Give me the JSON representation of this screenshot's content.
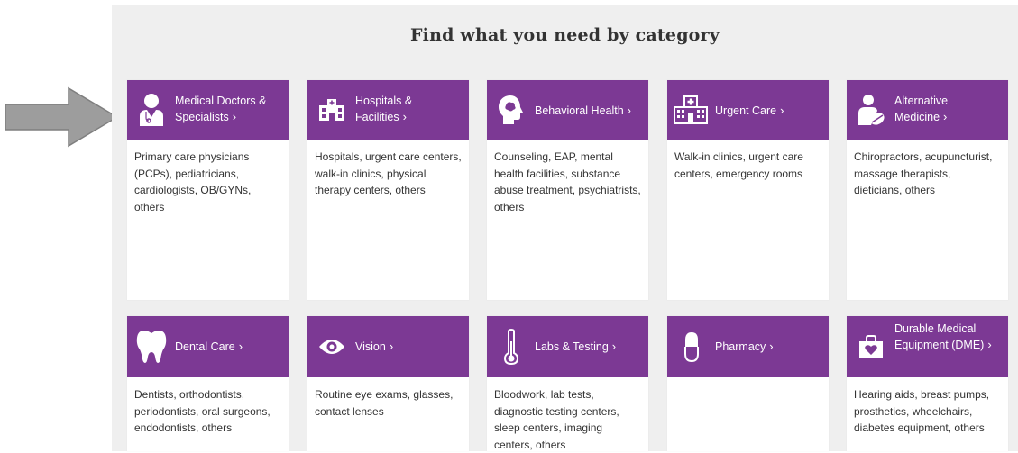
{
  "heading": "Find what you need by category",
  "colors": {
    "accent": "#7c3994",
    "panel": "#efefef",
    "arrow": "#9d9d9d",
    "text": "#333333"
  },
  "categories": [
    {
      "title": "Medical Doctors & Specialists",
      "icon": "doctor-icon",
      "description": "Primary care physicians (PCPs), pediatricians, cardiologists, OB/GYNs, others"
    },
    {
      "title": "Hospitals & Facilities",
      "icon": "hospital-building-icon",
      "description": "Hospitals, urgent care centers, walk-in clinics, physical therapy centers, others"
    },
    {
      "title": "Behavioral Health",
      "icon": "head-profile-icon",
      "description": "Counseling, EAP, mental health facilities, substance abuse treatment, psychiatrists, others"
    },
    {
      "title": "Urgent Care",
      "icon": "urgent-care-building-icon",
      "description": "Walk-in clinics, urgent care centers, emergency rooms"
    },
    {
      "title": "Alternative Medicine",
      "icon": "alternative-medicine-icon",
      "description": "Chiropractors, acupuncturist, massage therapists, dieticians, others"
    },
    {
      "title": "Dental Care",
      "icon": "tooth-icon",
      "description": "Dentists, orthodontists, periodontists, oral surgeons, endodontists, others"
    },
    {
      "title": "Vision",
      "icon": "eye-icon",
      "description": "Routine eye exams, glasses, contact lenses"
    },
    {
      "title": "Labs & Testing",
      "icon": "thermometer-icon",
      "description": "Bloodwork, lab tests, diagnostic testing centers, sleep centers, imaging centers, others"
    },
    {
      "title": "Pharmacy",
      "icon": "pill-capsule-icon",
      "description": ""
    },
    {
      "title": "Durable Medical Equipment (DME)",
      "icon": "medical-bag-icon",
      "description": "Hearing aids, breast pumps, prosthetics, wheelchairs, diabetes equipment, others"
    }
  ],
  "chevron": "›"
}
